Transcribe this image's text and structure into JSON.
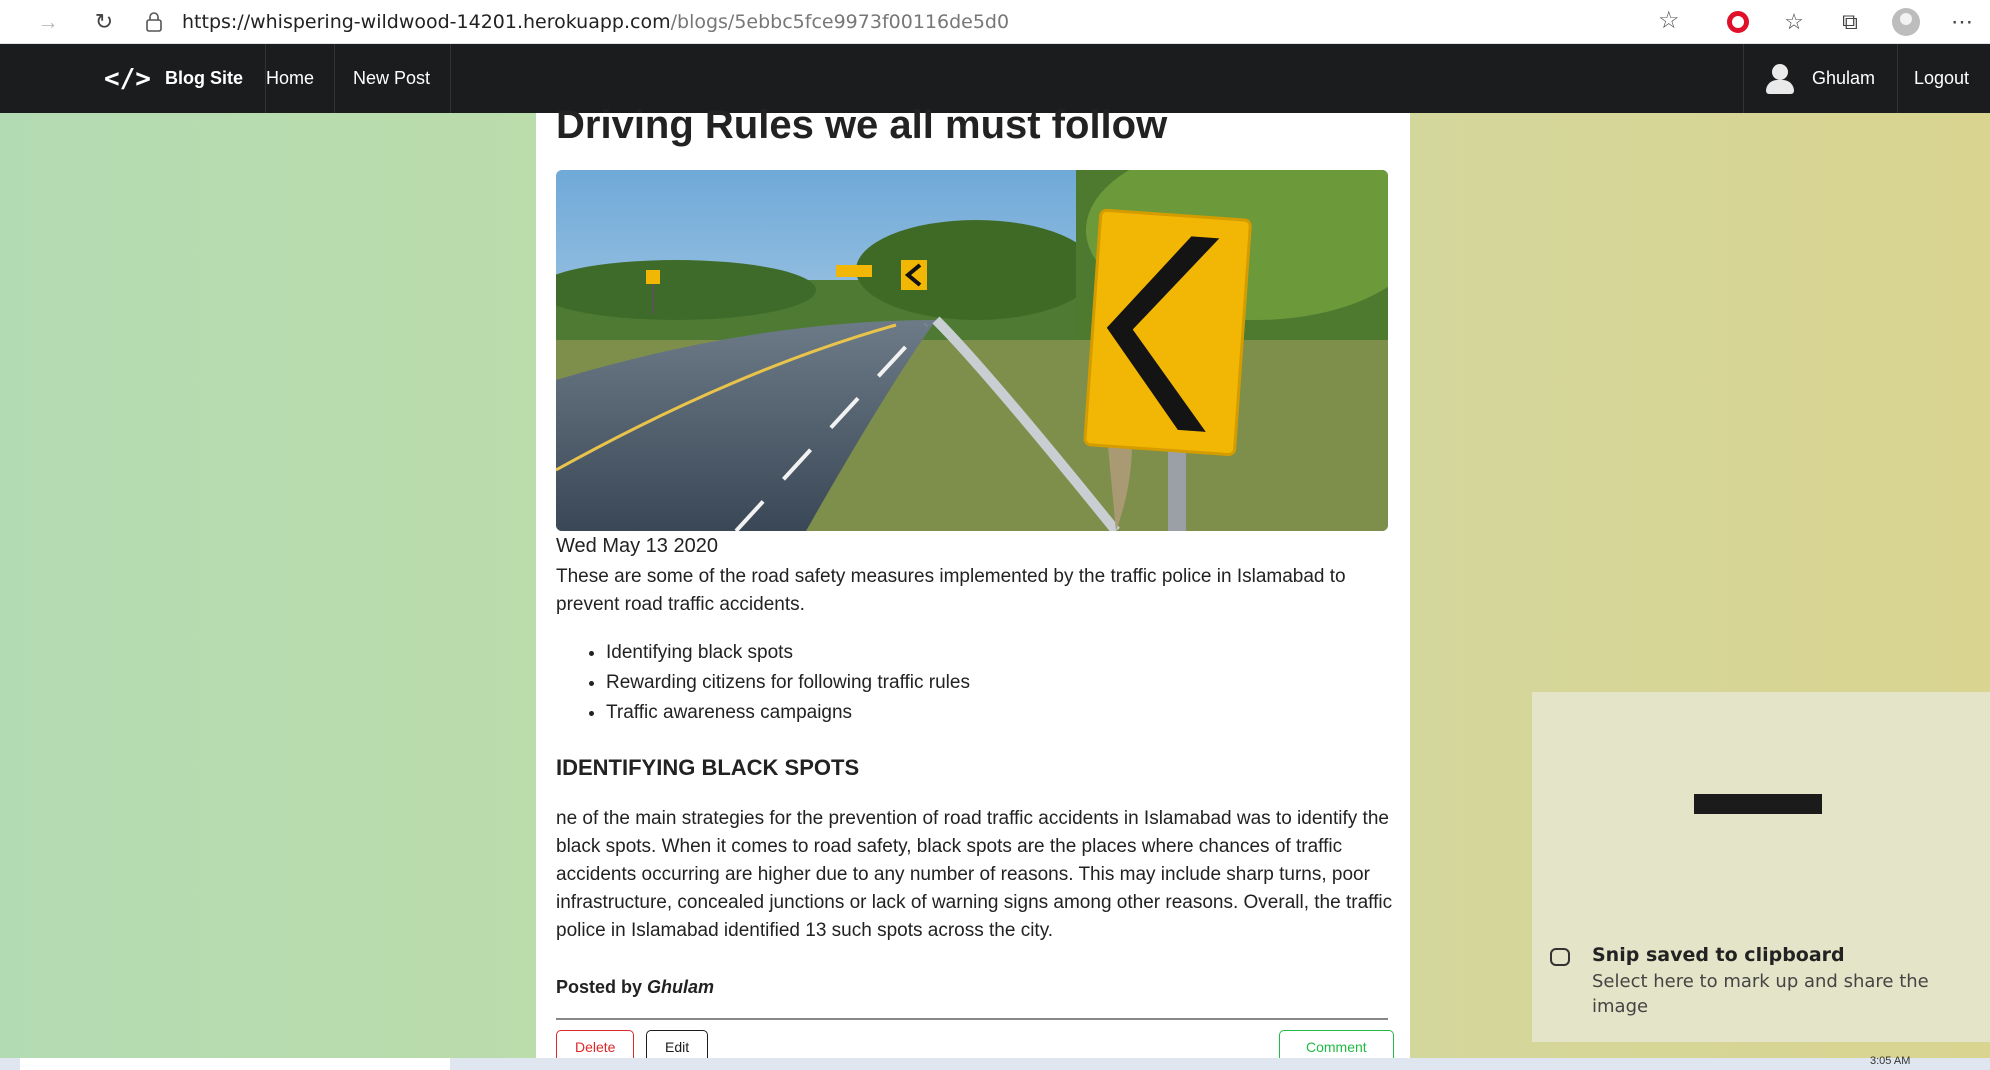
{
  "browser": {
    "url_host": "https://whispering-wildwood-14201.herokuapp.com",
    "url_path": "/blogs/5ebbc5fce9973f00116de5d0"
  },
  "navbar": {
    "brand": "Blog Site",
    "items": [
      "Home",
      "New Post"
    ],
    "user": "Ghulam",
    "logout": "Logout"
  },
  "post": {
    "title": "Driving Rules we all must follow",
    "date": "Wed May 13 2020",
    "intro": "These are some of the road safety measures implemented by the traffic police in Islamabad to prevent road traffic accidents.",
    "bullets": [
      "Identifying black spots",
      "Rewarding citizens for following traffic rules",
      "Traffic awareness campaigns"
    ],
    "section_heading": "IDENTIFYING BLACK SPOTS",
    "paragraph": "ne of the main strategies for the prevention of road traffic accidents in Islamabad was to identify the black spots. When it comes to road safety, black spots are the places where chances of traffic accidents occurring are higher due to any number of reasons. This may include sharp turns, poor infrastructure, concealed junctions or lack of warning signs among other reasons. Overall, the traffic police in Islamabad identified 13 such spots across the city.",
    "posted_by_label": "Posted by",
    "author": "Ghulam",
    "buttons": {
      "delete": "Delete",
      "edit": "Edit",
      "comment": "Comment"
    }
  },
  "toast": {
    "title": "Snip saved to clipboard",
    "subtitle": "Select here to mark up and share the image"
  },
  "taskbar": {
    "clock": "3:05 AM"
  },
  "colors": {
    "navbar": "#1b1c1d",
    "delete": "#db2828",
    "comment": "#21ba45",
    "sign_yellow": "#f2b705"
  }
}
